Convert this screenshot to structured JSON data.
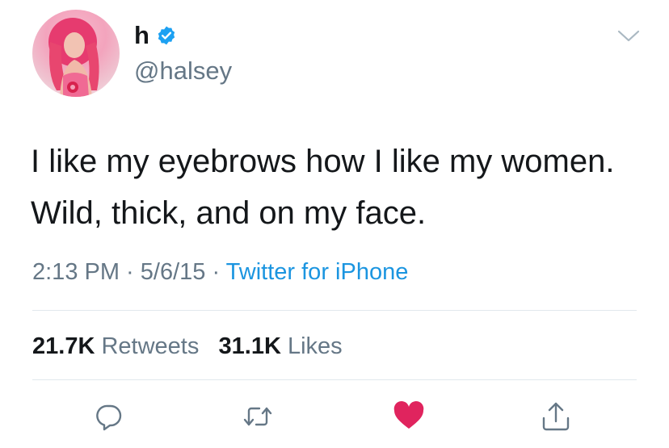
{
  "user": {
    "display_name": "h",
    "handle": "@halsey",
    "verified_icon": "verified-badge-icon"
  },
  "tweet": {
    "text": "I like my eyebrows how I like my women. Wild, thick, and on my face.",
    "time": "2:13 PM",
    "separator": " · ",
    "date": "5/6/15",
    "source": "Twitter for iPhone"
  },
  "stats": {
    "retweets_count": "21.7K",
    "retweets_label": "Retweets",
    "likes_count": "31.1K",
    "likes_label": "Likes"
  },
  "actions": {
    "reply_icon": "reply-icon",
    "retweet_icon": "retweet-icon",
    "like_icon": "heart-icon",
    "share_icon": "share-icon"
  },
  "colors": {
    "text_primary": "#14171a",
    "text_secondary": "#657786",
    "link": "#1b95e0",
    "verified": "#1da1f2",
    "like_active": "#e0245e",
    "icon_gray": "#657786"
  }
}
